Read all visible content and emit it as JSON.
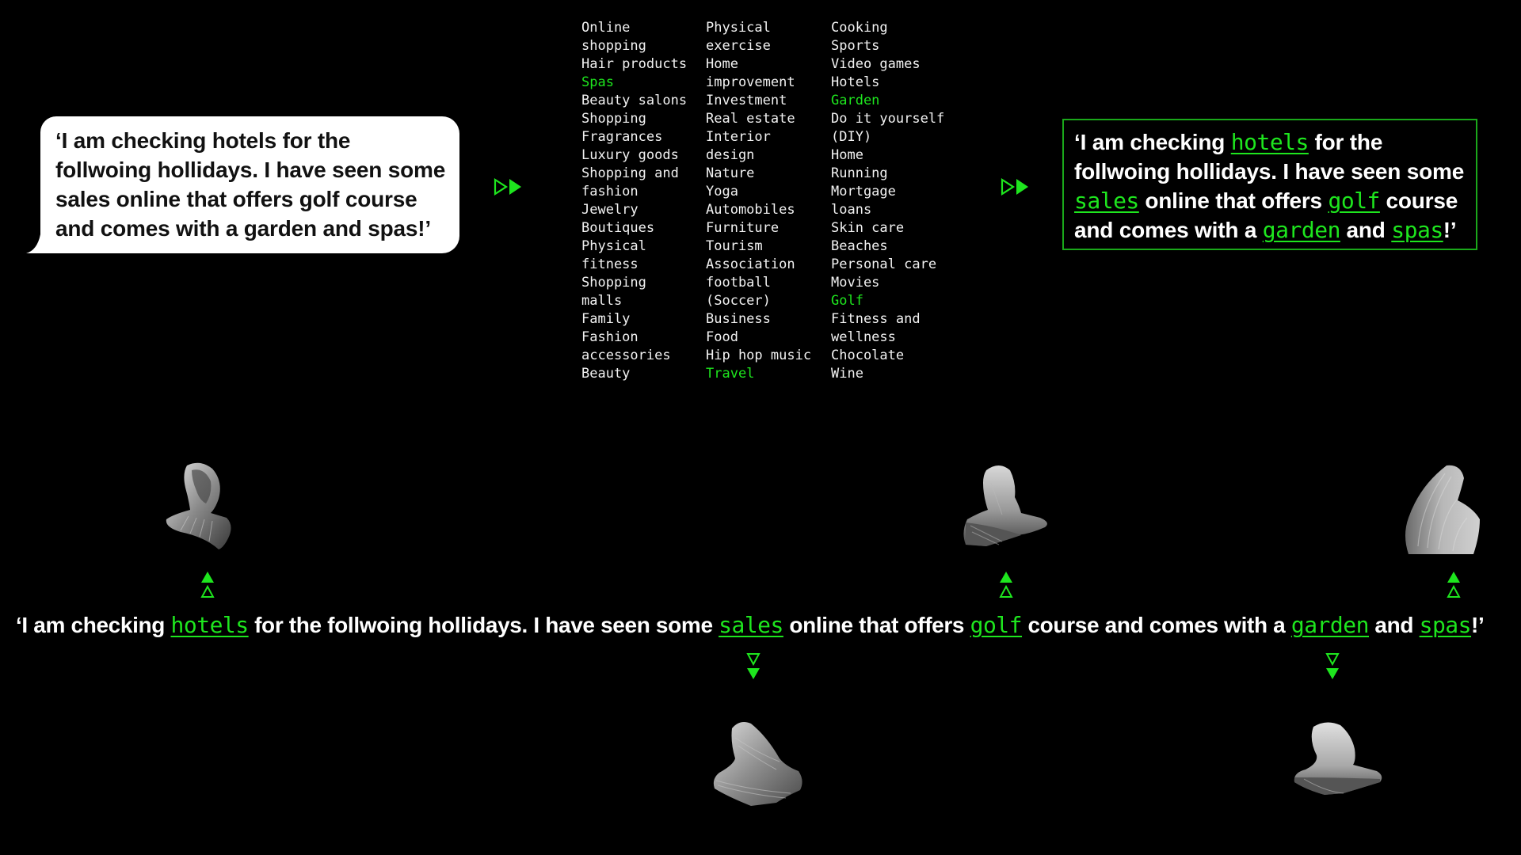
{
  "input_bubble": {
    "text": "‘I am checking hotels for the follwoing hollidays. I have seen some sales online that offers golf course and comes with a garden and spas!’"
  },
  "interest_categories": {
    "columns": [
      [
        {
          "label": "Online",
          "highlighted": false
        },
        {
          "label": "shopping",
          "highlighted": false
        },
        {
          "label": "Hair products",
          "highlighted": false
        },
        {
          "label": "Spas",
          "highlighted": true
        },
        {
          "label": "Beauty salons",
          "highlighted": false
        },
        {
          "label": "Shopping",
          "highlighted": false
        },
        {
          "label": "Fragrances",
          "highlighted": false
        },
        {
          "label": "Luxury goods",
          "highlighted": false
        },
        {
          "label": "Shopping and",
          "highlighted": false
        },
        {
          "label": "fashion",
          "highlighted": false
        },
        {
          "label": "Jewelry",
          "highlighted": false
        },
        {
          "label": "Boutiques",
          "highlighted": false
        },
        {
          "label": "Physical",
          "highlighted": false
        },
        {
          "label": "fitness",
          "highlighted": false
        },
        {
          "label": "Shopping",
          "highlighted": false
        },
        {
          "label": "malls",
          "highlighted": false
        },
        {
          "label": "Family",
          "highlighted": false
        },
        {
          "label": "Fashion",
          "highlighted": false
        },
        {
          "label": "accessories",
          "highlighted": false
        },
        {
          "label": "Beauty",
          "highlighted": false
        }
      ],
      [
        {
          "label": "Physical",
          "highlighted": false
        },
        {
          "label": "exercise",
          "highlighted": false
        },
        {
          "label": "Home",
          "highlighted": false
        },
        {
          "label": "improvement",
          "highlighted": false
        },
        {
          "label": "Investment",
          "highlighted": false
        },
        {
          "label": "Real estate",
          "highlighted": false
        },
        {
          "label": "Interior",
          "highlighted": false
        },
        {
          "label": "design",
          "highlighted": false
        },
        {
          "label": "Nature",
          "highlighted": false
        },
        {
          "label": "Yoga",
          "highlighted": false
        },
        {
          "label": "Automobiles",
          "highlighted": false
        },
        {
          "label": "Furniture",
          "highlighted": false
        },
        {
          "label": "Tourism",
          "highlighted": false
        },
        {
          "label": "Association",
          "highlighted": false
        },
        {
          "label": "football",
          "highlighted": false
        },
        {
          "label": "(Soccer)",
          "highlighted": false
        },
        {
          "label": "Business",
          "highlighted": false
        },
        {
          "label": "Food",
          "highlighted": false
        },
        {
          "label": "Hip hop music",
          "highlighted": false
        },
        {
          "label": "Travel",
          "highlighted": true
        }
      ],
      [
        {
          "label": "Cooking",
          "highlighted": false
        },
        {
          "label": "Sports",
          "highlighted": false
        },
        {
          "label": "Video games",
          "highlighted": false
        },
        {
          "label": "Hotels",
          "highlighted": false
        },
        {
          "label": "Garden",
          "highlighted": true
        },
        {
          "label": "Do it yourself",
          "highlighted": false
        },
        {
          "label": "(DIY)",
          "highlighted": false
        },
        {
          "label": "Home",
          "highlighted": false
        },
        {
          "label": "Running",
          "highlighted": false
        },
        {
          "label": "Mortgage",
          "highlighted": false
        },
        {
          "label": "loans",
          "highlighted": false
        },
        {
          "label": "Skin care",
          "highlighted": false
        },
        {
          "label": "Beaches",
          "highlighted": false
        },
        {
          "label": "Personal care",
          "highlighted": false
        },
        {
          "label": "Movies",
          "highlighted": false
        },
        {
          "label": "Golf",
          "highlighted": true
        },
        {
          "label": "Fitness and",
          "highlighted": false
        },
        {
          "label": "wellness",
          "highlighted": false
        },
        {
          "label": "Chocolate",
          "highlighted": false
        },
        {
          "label": "Wine",
          "highlighted": false
        }
      ]
    ]
  },
  "annotated_box": {
    "segments": [
      {
        "text": "‘I am checking ",
        "highlighted": false
      },
      {
        "text": "hotels",
        "highlighted": true
      },
      {
        "text": " for the follwoing hollidays. I have seen some ",
        "highlighted": false
      },
      {
        "text": "sales",
        "highlighted": true
      },
      {
        "text": " online that offers ",
        "highlighted": false
      },
      {
        "text": "golf",
        "highlighted": true
      },
      {
        "text": " course and comes with a ",
        "highlighted": false
      },
      {
        "text": "garden",
        "highlighted": true
      },
      {
        "text": " and ",
        "highlighted": false
      },
      {
        "text": "spas",
        "highlighted": true
      },
      {
        "text": "!’",
        "highlighted": false
      }
    ]
  },
  "bottom_sentence": {
    "segments": [
      {
        "text": "‘I am checking ",
        "highlighted": false
      },
      {
        "text": "hotels",
        "highlighted": true
      },
      {
        "text": " for the follwoing hollidays. I have seen some ",
        "highlighted": false
      },
      {
        "text": "sales",
        "highlighted": true
      },
      {
        "text": " online that offers ",
        "highlighted": false
      },
      {
        "text": "golf",
        "highlighted": true
      },
      {
        "text": " course and comes with a ",
        "highlighted": false
      },
      {
        "text": "garden",
        "highlighted": true
      },
      {
        "text": " and ",
        "highlighted": false
      },
      {
        "text": "spas",
        "highlighted": true
      },
      {
        "text": "!’",
        "highlighted": false
      }
    ]
  },
  "flow_arrows": {
    "right_arrow_icon": "fast-forward-icon",
    "up_arrow_icon": "up-triangles-icon",
    "down_arrow_icon": "down-triangles-icon"
  },
  "busts": [
    {
      "name": "bust-hotels",
      "linked_word": "hotels",
      "direction": "up"
    },
    {
      "name": "bust-golf",
      "linked_word": "golf",
      "direction": "up"
    },
    {
      "name": "bust-spas",
      "linked_word": "spas",
      "direction": "up"
    },
    {
      "name": "bust-sales",
      "linked_word": "sales",
      "direction": "down"
    },
    {
      "name": "bust-garden",
      "linked_word": "garden",
      "direction": "down"
    }
  ],
  "colors": {
    "accent_green": "#1ee61e",
    "box_border": "#1aa81a",
    "background": "#000000",
    "bubble": "#ffffff"
  }
}
